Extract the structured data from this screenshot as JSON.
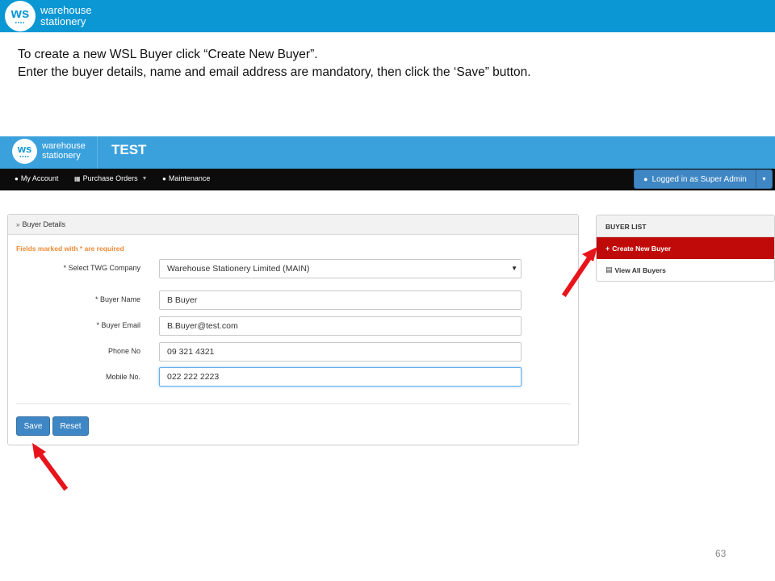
{
  "brand": {
    "mark": "ws",
    "dots": "••••",
    "line1": "warehouse",
    "line2": "stationery"
  },
  "instructions": {
    "line1": "To create a new WSL Buyer click “Create New Buyer”.",
    "line2": "Enter the buyer details, name and email address are mandatory, then click the ‘Save” button."
  },
  "app": {
    "title": "TEST"
  },
  "nav": {
    "my_account": "My Account",
    "purchase_orders": "Purchase Orders",
    "maintenance": "Maintenance",
    "logged_in": "Logged in as Super Admin"
  },
  "panel": {
    "title": "Buyer Details",
    "required_note": "Fields marked with * are required",
    "fields": [
      {
        "label": "* Select TWG Company",
        "value": "Warehouse Stationery Limited (MAIN)"
      },
      {
        "label": "* Buyer Name",
        "value": "B Buyer"
      },
      {
        "label": "* Buyer Email",
        "value": "B.Buyer@test.com"
      },
      {
        "label": "Phone No",
        "value": "09 321 4321"
      },
      {
        "label": "Mobile No.",
        "value": "022 222 2223"
      }
    ],
    "save_label": "Save",
    "reset_label": "Reset"
  },
  "buyer_list": {
    "title": "BUYER LIST",
    "create_label": "Create New Buyer",
    "view_label": "View All Buyers"
  },
  "page_number": "63",
  "colors": {
    "banner": "#0b97d4",
    "app_header": "#3ba1dd",
    "navbar": "#0c0c0c",
    "primary_button": "#3f87c4",
    "active_item": "#c00a0a",
    "arrow": "#e8141b",
    "required_note": "#ef8a35"
  }
}
